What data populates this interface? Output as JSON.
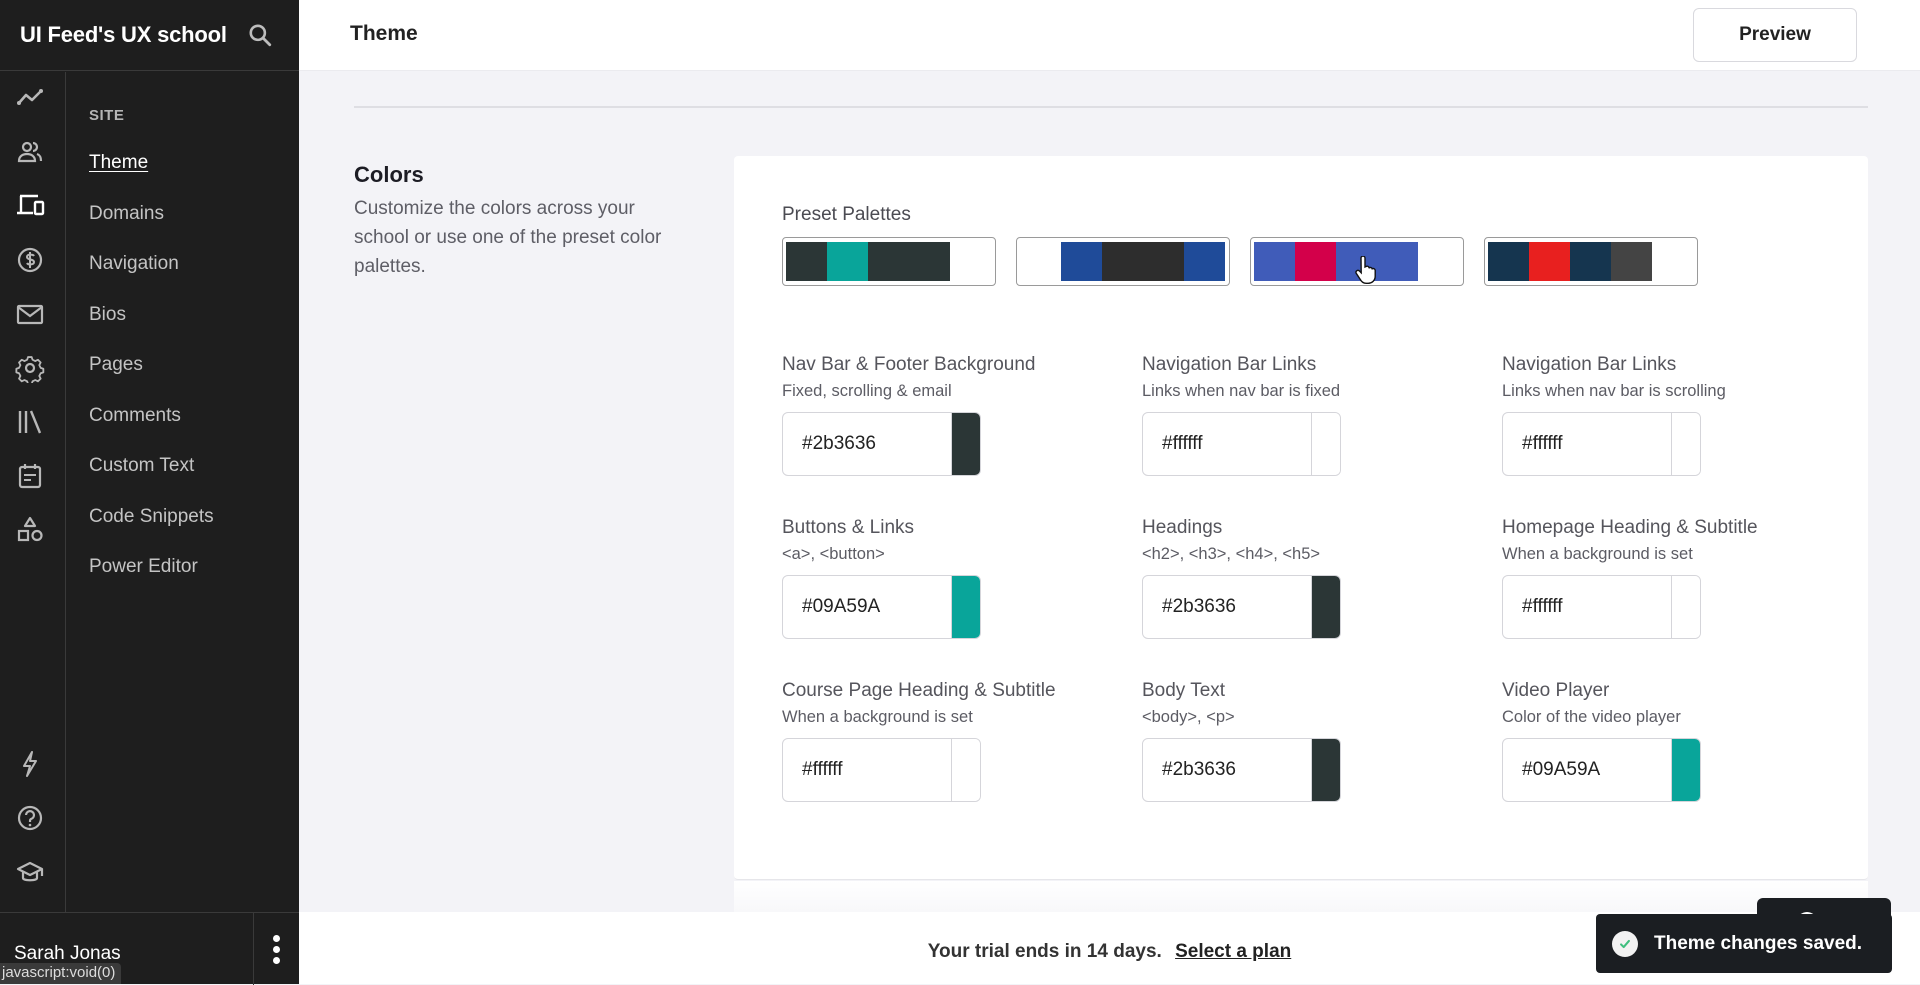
{
  "brand": {
    "title": "UI Feed's UX school",
    "search_icon": "search-icon"
  },
  "rail_icons": [
    {
      "name": "analytics-icon",
      "active": false
    },
    {
      "name": "users-icon",
      "active": false
    },
    {
      "name": "devices-icon",
      "active": true
    },
    {
      "name": "dollar-icon",
      "active": false
    },
    {
      "name": "mail-icon",
      "active": false
    },
    {
      "name": "gear-icon",
      "active": false
    },
    {
      "name": "library-icon",
      "active": false
    },
    {
      "name": "calendar-icon",
      "active": false
    },
    {
      "name": "shapes-icon",
      "active": false
    },
    {
      "name": "lightning-icon",
      "active": false
    },
    {
      "name": "help-icon",
      "active": false
    },
    {
      "name": "graduation-cap-icon",
      "active": false
    }
  ],
  "nav": {
    "section": "SITE",
    "items": [
      {
        "label": "Theme",
        "active": true
      },
      {
        "label": "Domains"
      },
      {
        "label": "Navigation"
      },
      {
        "label": "Bios"
      },
      {
        "label": "Pages"
      },
      {
        "label": "Comments"
      },
      {
        "label": "Custom Text"
      },
      {
        "label": "Code Snippets"
      },
      {
        "label": "Power Editor"
      }
    ]
  },
  "user": {
    "name": "Sarah Jonas",
    "menu_icon": "more-vertical-icon"
  },
  "status_url": "javascript:void(0)",
  "header": {
    "title": "Theme",
    "preview_label": "Preview"
  },
  "colors_section": {
    "title": "Colors",
    "description": "Customize the colors across your school or use one of the preset color palettes.",
    "preset_label": "Preset Palettes",
    "palettes": [
      [
        "#2b3636",
        "#09A59A",
        "#2b3636",
        "#2b3636",
        "#ffffff"
      ],
      [
        "#ffffff",
        "#1f4b99",
        "#2d2d2d",
        "#2d2d2d",
        "#1f4b99"
      ],
      [
        "#405cb9",
        "#d3004a",
        "#405cb9",
        "#405cb9",
        "#ffffff"
      ],
      [
        "#15354f",
        "#e8201f",
        "#15354f",
        "#444444",
        "#ffffff"
      ]
    ],
    "fields": [
      {
        "label": "Nav Bar & Footer Background",
        "sub": "Fixed, scrolling & email",
        "value": "#2b3636",
        "swatch": "#2b3636"
      },
      {
        "label": "Navigation Bar Links",
        "sub": "Links when nav bar is fixed",
        "value": "#ffffff",
        "swatch": "#ffffff"
      },
      {
        "label": "Navigation Bar Links",
        "sub": "Links when nav bar is scrolling",
        "value": "#ffffff",
        "swatch": "#ffffff"
      },
      {
        "label": "Buttons & Links",
        "sub": "<a>, <button>",
        "value": "#09A59A",
        "swatch": "#09A59A"
      },
      {
        "label": "Headings",
        "sub": "<h2>, <h3>, <h4>, <h5>",
        "value": "#2b3636",
        "swatch": "#2b3636"
      },
      {
        "label": "Homepage Heading & Subtitle",
        "sub": "When a background is set",
        "value": "#ffffff",
        "swatch": "#ffffff"
      },
      {
        "label": "Course Page Heading & Subtitle",
        "sub": "When a background is set",
        "value": "#ffffff",
        "swatch": "#ffffff"
      },
      {
        "label": "Body Text",
        "sub": "<body>, <p>",
        "value": "#2b3636",
        "swatch": "#2b3636"
      },
      {
        "label": "Video Player",
        "sub": "Color of the video player",
        "value": "#09A59A",
        "swatch": "#09A59A"
      }
    ]
  },
  "trial": {
    "text": "Your trial ends in 14 days.",
    "link": "Select a plan"
  },
  "toast": {
    "text": "Theme changes saved.",
    "check_color": "#3fbf7f"
  }
}
